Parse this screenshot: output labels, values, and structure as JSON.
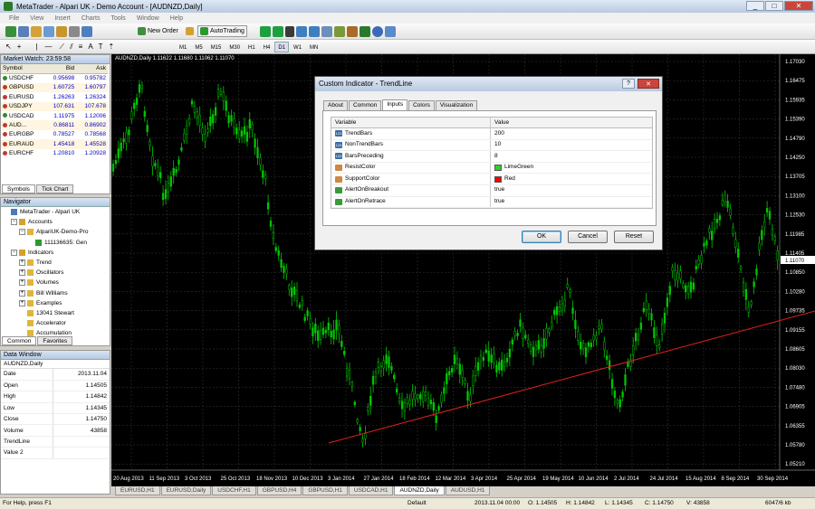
{
  "window": {
    "title": "MetaTrader - Alpari UK - Demo Account - [AUDNZD,Daily]",
    "minimize": "_",
    "maximize": "□",
    "close": "✕"
  },
  "menu": [
    "File",
    "View",
    "Insert",
    "Charts",
    "Tools",
    "Window",
    "Help"
  ],
  "toolbar": {
    "new_order": "New Order",
    "autotrading": "AutoTrading",
    "timeframes": [
      "M1",
      "M5",
      "M15",
      "M30",
      "H1",
      "H4",
      "D1",
      "W1",
      "MN"
    ],
    "active_timeframe": "D1"
  },
  "market_watch": {
    "title": "Market Watch: 23:59:58",
    "headers": [
      "Symbol",
      "Bid",
      "Ask"
    ],
    "rows": [
      {
        "symbol": "USDCHF",
        "bid": "0.95698",
        "ask": "0.95782",
        "color": "#2e8b2e"
      },
      {
        "symbol": "GBPUSD",
        "bid": "1.60725",
        "ask": "1.60797",
        "color": "#c0392b"
      },
      {
        "symbol": "EURUSD",
        "bid": "1.26263",
        "ask": "1.26324",
        "color": "#c0392b"
      },
      {
        "symbol": "USDJPY",
        "bid": "107.631",
        "ask": "107.678",
        "color": "#c0392b"
      },
      {
        "symbol": "USDCAD",
        "bid": "1.11975",
        "ask": "1.12006",
        "color": "#2e8b2e"
      },
      {
        "symbol": "AUD...",
        "bid": "0.86811",
        "ask": "0.86902",
        "color": "#c0392b"
      },
      {
        "symbol": "EURGBP",
        "bid": "0.78527",
        "ask": "0.78568",
        "color": "#c0392b"
      },
      {
        "symbol": "EURAUD",
        "bid": "1.45418",
        "ask": "1.45528",
        "color": "#c0392b"
      },
      {
        "symbol": "EURCHF",
        "bid": "1.20810",
        "ask": "1.20928",
        "color": "#c0392b"
      }
    ],
    "tabs": [
      "Symbols",
      "Tick Chart"
    ]
  },
  "navigator": {
    "title": "Navigator",
    "items": [
      {
        "label": "MetaTrader - Alpari UK",
        "indent": 0,
        "expander": ""
      },
      {
        "label": "Accounts",
        "indent": 1,
        "expander": "−"
      },
      {
        "label": "AlpariUK-Demo-Pro",
        "indent": 2,
        "expander": "−"
      },
      {
        "label": "111136635: Gen",
        "indent": 3,
        "expander": ""
      },
      {
        "label": "Indicators",
        "indent": 1,
        "expander": "−"
      },
      {
        "label": "Trend",
        "indent": 2,
        "expander": "+"
      },
      {
        "label": "Oscillators",
        "indent": 2,
        "expander": "+"
      },
      {
        "label": "Volumes",
        "indent": 2,
        "expander": "+"
      },
      {
        "label": "Bill Williams",
        "indent": 2,
        "expander": "+"
      },
      {
        "label": "Examples",
        "indent": 2,
        "expander": "+"
      },
      {
        "label": "13041 Stewart",
        "indent": 2,
        "expander": ""
      },
      {
        "label": "Accelerator",
        "indent": 2,
        "expander": ""
      },
      {
        "label": "Accumulation",
        "indent": 2,
        "expander": ""
      }
    ],
    "tabs": [
      "Common",
      "Favorites"
    ]
  },
  "data_window": {
    "title": "Data Window",
    "symbol": "AUDNZD,Daily",
    "rows": [
      {
        "k": "Date",
        "v": "2013.11.04"
      },
      {
        "k": "Open",
        "v": "1.14505"
      },
      {
        "k": "High",
        "v": "1.14842"
      },
      {
        "k": "Low",
        "v": "1.14345"
      },
      {
        "k": "Close",
        "v": "1.14750"
      },
      {
        "k": "Volume",
        "v": "43858"
      },
      {
        "k": "TrendLine",
        "v": ""
      },
      {
        "k": "Value 2",
        "v": ""
      }
    ]
  },
  "chart": {
    "label": "AUDNZD,Daily  1.11622 1.11680 1.11062 1.11070",
    "price_labels": [
      "1.17030",
      "1.16475",
      "1.15935",
      "1.15390",
      "1.14790",
      "1.14250",
      "1.13705",
      "1.13100",
      "1.12530",
      "1.11985",
      "1.11405",
      "1.10850",
      "1.10280",
      "1.09735",
      "1.09155",
      "1.08605",
      "1.08030",
      "1.07480",
      "1.06905",
      "1.06355",
      "1.05780",
      "1.05210"
    ],
    "current_price": "1.11070",
    "date_labels": [
      "20 Aug 2013",
      "11 Sep 2013",
      "3 Oct 2013",
      "25 Oct 2013",
      "18 Nov 2013",
      "10 Dec 2013",
      "3 Jan 2014",
      "27 Jan 2014",
      "18 Feb 2014",
      "12 Mar 2014",
      "3 Apr 2014",
      "25 Apr 2014",
      "19 May 2014",
      "10 Jun 2014",
      "2 Jul 2014",
      "24 Jul 2014",
      "15 Aug 2014",
      "8 Sep 2014",
      "30 Sep 2014"
    ],
    "candle_color": "#00c800",
    "trendline_color": "#e02020"
  },
  "symbol_tabs": [
    "EURUSD,H1",
    "EURUSD,Daily",
    "USDCHF,H1",
    "GBPUSD,H4",
    "GBPUSD,H1",
    "USDCAD,H1",
    "AUDNZD,Daily",
    "AUDUSD,H1"
  ],
  "active_symbol_tab": "AUDNZD,Daily",
  "status": {
    "help": "For Help, press F1",
    "profile": "Default",
    "time": "2013.11.04 00:00",
    "open": "O: 1.14505",
    "high": "H: 1.14842",
    "low": "L: 1.14345",
    "close": "C: 1.14750",
    "volume": "V: 43858",
    "traffic": "6047/6 kb"
  },
  "dialog": {
    "title": "Custom Indicator - TrendLine",
    "help": "?",
    "close": "✕",
    "tabs": [
      "About",
      "Common",
      "Inputs",
      "Colors",
      "Visualization"
    ],
    "active_tab": "Inputs",
    "col_variable": "Variable",
    "col_value": "Value",
    "params": [
      {
        "name": "TrendBars",
        "value": "200",
        "type": "int"
      },
      {
        "name": "NonTrendBars",
        "value": "10",
        "type": "int"
      },
      {
        "name": "BarsPreceding",
        "value": "8",
        "type": "int"
      },
      {
        "name": "ResistColor",
        "value": "LimeGreen",
        "type": "color",
        "color": "#32cd32"
      },
      {
        "name": "SupportColor",
        "value": "Red",
        "type": "color",
        "color": "#ff0000"
      },
      {
        "name": "AlertOnBreakout",
        "value": "true",
        "type": "bool"
      },
      {
        "name": "AlertOnRetrace",
        "value": "true",
        "type": "bool"
      }
    ],
    "ok": "OK",
    "cancel": "Cancel",
    "reset": "Reset"
  }
}
